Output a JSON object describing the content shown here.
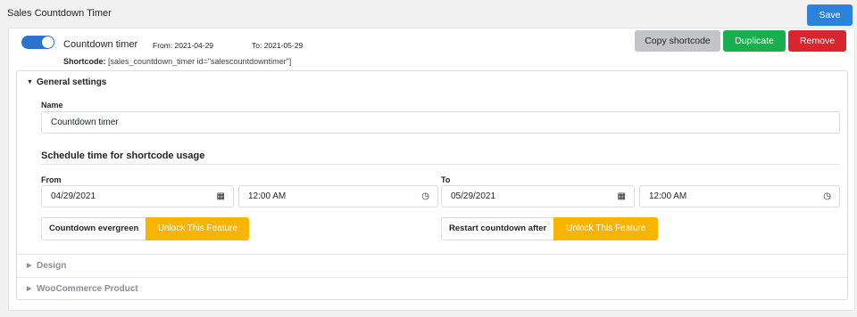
{
  "page": {
    "title": "Sales Countdown Timer",
    "save_label": "Save"
  },
  "timer": {
    "enabled": true,
    "name": "Countdown timer",
    "from": "From: 2021-04-29",
    "to": "To: 2021-05-29",
    "shortcode_label": "Shortcode:",
    "shortcode_value": "[sales_countdown_timer id=\"salescountdowntimer\"]"
  },
  "actions": {
    "copy": "Copy shortcode",
    "duplicate": "Duplicate",
    "remove": "Remove"
  },
  "general": {
    "title": "General settings",
    "name_label": "Name",
    "name_value": "Countdown timer",
    "schedule_title": "Schedule time for shortcode usage",
    "from_label": "From",
    "from_date": "04/29/2021",
    "from_time": "12:00 AM",
    "to_label": "To",
    "to_date": "05/29/2021",
    "to_time": "12:00 AM",
    "evergreen_label": "Countdown evergreen",
    "restart_label": "Restart countdown after",
    "unlock_label": "Unlock This Feature"
  },
  "sections": {
    "design": "Design",
    "woo": "WooCommerce Product"
  },
  "colors": {
    "primary": "#2a82da",
    "success": "#1aae4f",
    "danger": "#d9262e",
    "unlock": "#f8b500"
  }
}
